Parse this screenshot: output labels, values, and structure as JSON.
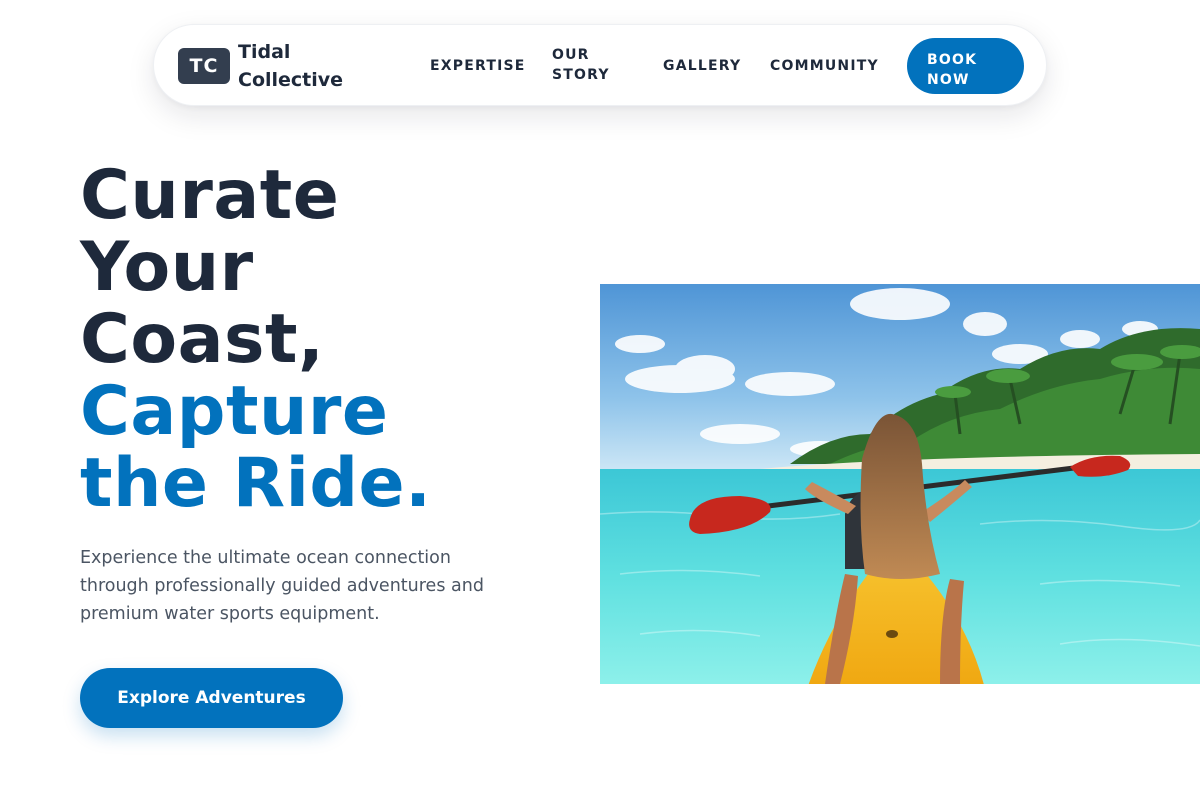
{
  "brand": {
    "badge": "TC",
    "name": "Tidal Collective"
  },
  "nav": {
    "links": [
      "EXPERTISE",
      "OUR STORY",
      "GALLERY",
      "COMMUNITY"
    ],
    "cta_label": "BOOK NOW"
  },
  "hero": {
    "headline_dark": [
      "Curate",
      "Your",
      "Coast,"
    ],
    "headline_blue": [
      "Capture",
      "the Ride."
    ],
    "subtext": "Experience the ultimate ocean connection through professionally guided adventures and premium water sports equipment.",
    "cta_label": "Explore Adventures"
  },
  "colors": {
    "accent": "#0272bd",
    "heading": "#1e293b",
    "badge": "#333e4f",
    "body_text": "#4b5563"
  }
}
